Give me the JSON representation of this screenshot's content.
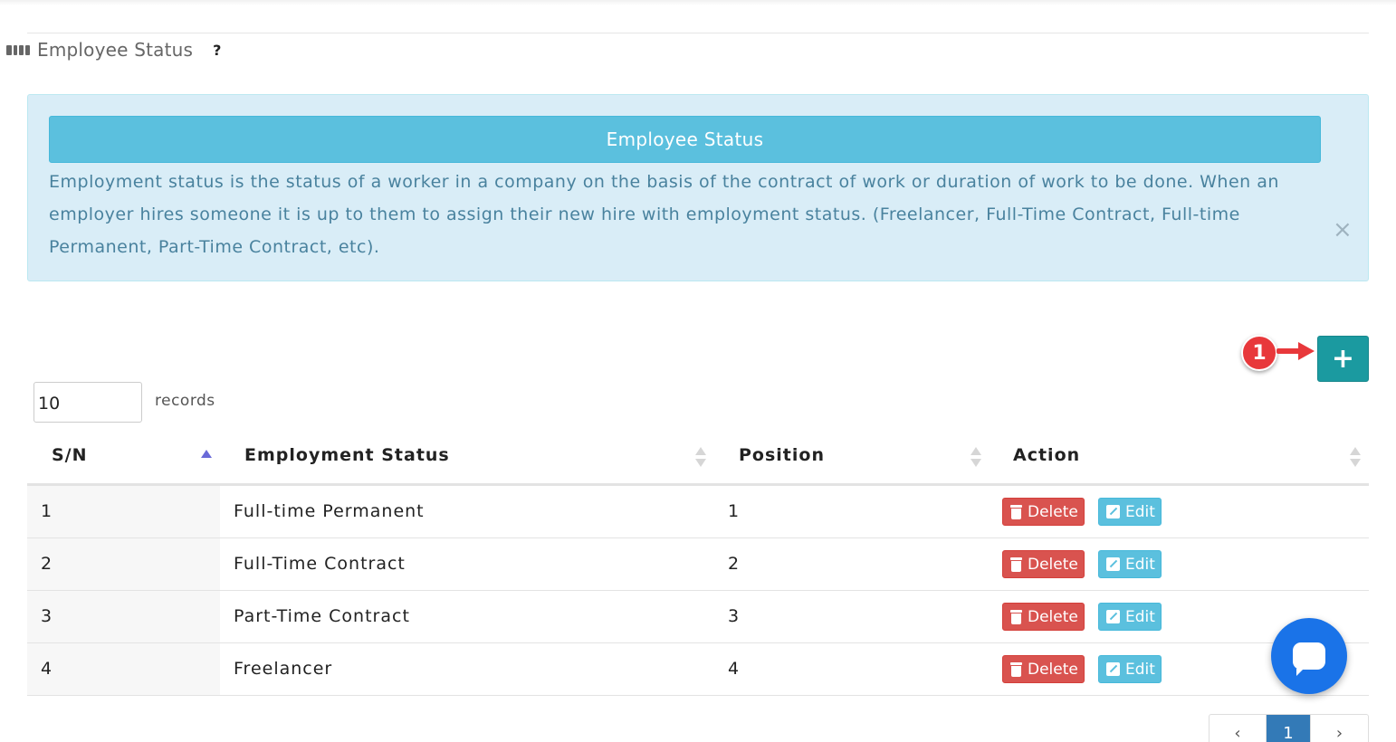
{
  "header": {
    "title": "Employee Status",
    "help": "?"
  },
  "info": {
    "heading": "Employee Status",
    "text": "Employment status is the status of a worker in a company on the basis of the contract of work or duration of work to be done. When an employer hires someone it is up to them to assign their new hire with employment status. (Freelancer, Full-Time Contract, Full-time Permanent, Part-Time Contract, etc).",
    "close": "×"
  },
  "callout": {
    "number": "1"
  },
  "toolbar": {
    "add_label": "+"
  },
  "records": {
    "value": "10",
    "label": "records"
  },
  "table": {
    "columns": [
      "S/N",
      "Employment Status",
      "Position",
      "Action"
    ],
    "rows": [
      {
        "sn": "1",
        "status": "Full-time Permanent",
        "position": "1"
      },
      {
        "sn": "2",
        "status": "Full-Time Contract",
        "position": "2"
      },
      {
        "sn": "3",
        "status": "Part-Time Contract",
        "position": "3"
      },
      {
        "sn": "4",
        "status": "Freelancer",
        "position": "4"
      }
    ],
    "delete_label": "Delete",
    "edit_label": "Edit"
  },
  "pagination": {
    "prev": "‹",
    "current": "1",
    "next": "›"
  },
  "colors": {
    "info_bg": "#d9edf7",
    "info_head": "#5bc0de",
    "add_button": "#1b9aa0",
    "delete": "#d9534f",
    "edit": "#5bc0de",
    "callout": "#e8383b",
    "chat": "#1a73e8",
    "page_active": "#337ab7"
  }
}
